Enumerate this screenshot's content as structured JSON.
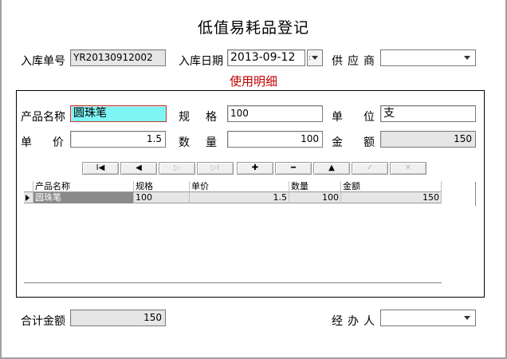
{
  "form": {
    "title": "低值易耗品登记",
    "receipt_no_label": "入库单号",
    "receipt_no_value": "YR20130912002",
    "receipt_date_label": "入库日期",
    "receipt_date_value": "2013-09-12",
    "supplier_label": "供应商",
    "supplier_value": ""
  },
  "detail": {
    "section_title": "使用明细",
    "product_name_label": "产品名称",
    "product_name_value": "圆珠笔",
    "spec_label": "规格",
    "spec_value": "100",
    "unit_label": "单位",
    "unit_value": "支",
    "price_label": "单价",
    "price_value": "1.5",
    "qty_label": "数量",
    "qty_value": "100",
    "amount_label": "金额",
    "amount_value": "150"
  },
  "navigator": {
    "first": "I◀",
    "prior": "◀",
    "next": "▷",
    "last": "▷I",
    "insert": "✚",
    "delete": "━",
    "edit": "▲",
    "post": "✓",
    "cancel": "✕"
  },
  "grid": {
    "columns": [
      "产品名称",
      "规格",
      "单价",
      "数量",
      "金额"
    ],
    "rows": [
      [
        "圆珠笔",
        "100",
        "1.5",
        "100",
        "150"
      ]
    ]
  },
  "footer": {
    "total_label": "合计金额",
    "total_value": "150",
    "handler_label": "经办人",
    "handler_value": ""
  }
}
